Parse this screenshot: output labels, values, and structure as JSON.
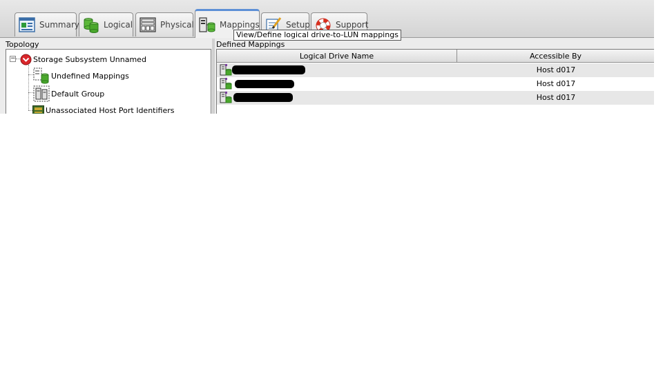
{
  "tabs": [
    {
      "label": "Summary",
      "icon": "summary-icon",
      "active": false
    },
    {
      "label": "Logical",
      "icon": "logical-drives-icon",
      "active": false
    },
    {
      "label": "Physical",
      "icon": "physical-drives-icon",
      "active": false
    },
    {
      "label": "Mappings",
      "icon": "mappings-icon",
      "active": true
    },
    {
      "label": "Setup",
      "icon": "setup-icon",
      "active": false
    },
    {
      "label": "Support",
      "icon": "support-lifebuoy-icon",
      "active": false
    }
  ],
  "tooltip": "View/Define logical drive-to-LUN mappings",
  "topology": {
    "title": "Topology",
    "root": {
      "label": "Storage Subsystem Unnamed",
      "icon": "storage-subsystem-icon",
      "expander": "−"
    },
    "children": [
      {
        "label": "Undefined Mappings",
        "icon": "undefined-mappings-icon"
      },
      {
        "label": "Default Group",
        "icon": "default-group-icon"
      },
      {
        "label": "Unassociated Host Port Identifiers",
        "icon": "host-port-icon"
      }
    ]
  },
  "mappings": {
    "title": "Defined Mappings",
    "columns": [
      "Logical Drive Name",
      "Accessible By"
    ],
    "rows": [
      {
        "drive": "",
        "accessible_by": "Host d017"
      },
      {
        "drive": "",
        "accessible_by": "Host d017"
      },
      {
        "drive": "",
        "accessible_by": "Host d017"
      }
    ]
  },
  "colors": {
    "active_tab_accent": "#5c8fd6",
    "alt_row": "#e7e7e7"
  }
}
